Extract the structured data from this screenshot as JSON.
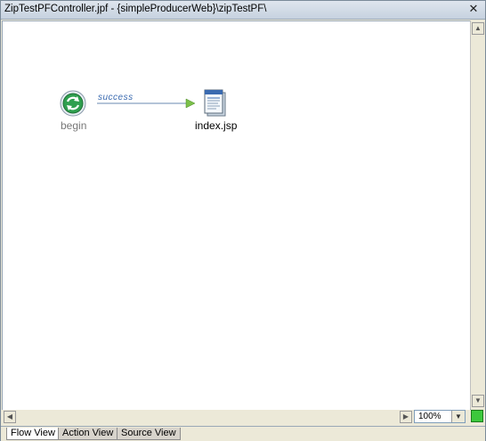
{
  "window": {
    "title": "ZipTestPFController.jpf - {simpleProducerWeb}\\zipTestPF\\",
    "close_glyph": "✕"
  },
  "flow": {
    "begin_label": "begin",
    "edge_label": "success",
    "page_label": "index.jsp"
  },
  "zoom": {
    "value": "100%"
  },
  "tabs": [
    {
      "label": "Flow View",
      "active": true
    },
    {
      "label": "Action View",
      "active": false
    },
    {
      "label": "Source View",
      "active": false
    }
  ],
  "colors": {
    "status_ok": "#3cc83c",
    "edge": "#3a6ab0",
    "begin_icon": "#2f9f4f"
  },
  "icons": {
    "begin": "refresh-cycle-icon",
    "page": "jsp-document-icon",
    "status": "status-indicator-icon"
  }
}
